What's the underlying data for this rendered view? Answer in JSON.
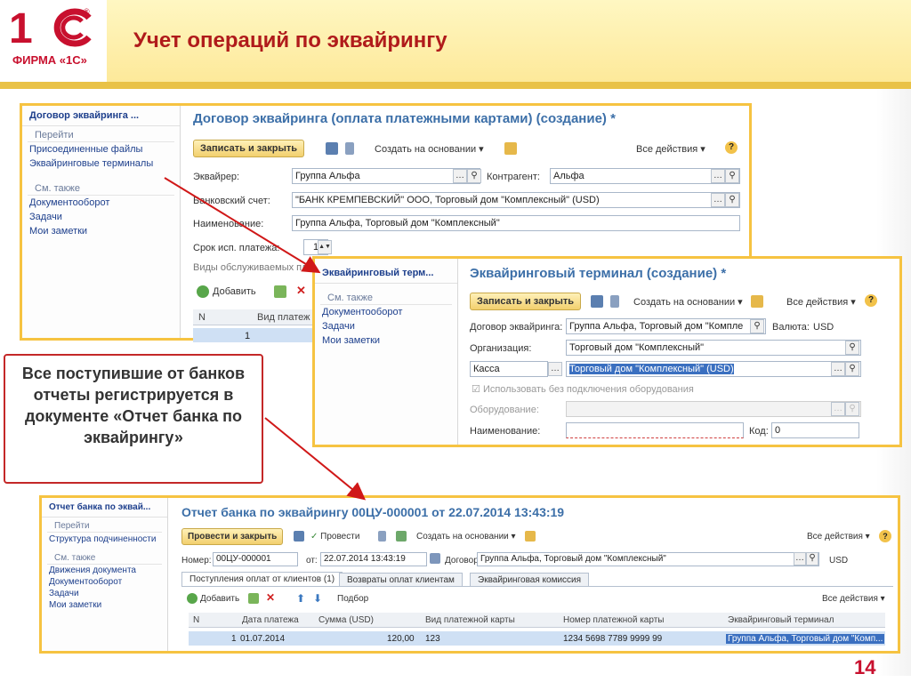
{
  "slide": {
    "logo_text": "ФИРМА «1С»",
    "title": "Учет операций по эквайрингу",
    "page_number": "14",
    "callout": "Все поступившие от банков отчеты регистрируется в документе «Отчет банка по эквайрингу»"
  },
  "colors": {
    "accent": "#f6c341",
    "title": "#b01b1b",
    "link": "#1d3f8c",
    "window_title": "#3c6fa8"
  },
  "win1": {
    "side_title": "Договор эквайринга ...",
    "side_h1": "Перейти",
    "side_links1": [
      "Присоединенные файлы",
      "Эквайринговые терминалы"
    ],
    "side_h2": "См. также",
    "side_links2": [
      "Документооборот",
      "Задачи",
      "Мои заметки"
    ],
    "title": "Договор эквайринга (оплата платежными картами) (создание) *",
    "btn_save": "Записать и закрыть",
    "create_based": "Создать на основании",
    "all_actions": "Все действия",
    "acquirer_label": "Эквайрер:",
    "acquirer_value": "Группа Альфа",
    "counterparty_label": "Контрагент:",
    "counterparty_value": "Альфа",
    "bank_label": "Банковский счет:",
    "bank_value": "\"БАНК КРЕМПЕВСКИЙ\" ООО, Торговый дом \"Комплексный\" (USD)",
    "name_label": "Наименование:",
    "name_value": "Группа Альфа, Торговый дом \"Комплексный\"",
    "term_label": "Срок исп. платежа:",
    "term_value": "1",
    "types_label": "Виды обслуживаемых пл",
    "add_label": "Добавить",
    "grid_cols": [
      "N",
      "Вид платеж"
    ],
    "grid_row": [
      "1"
    ]
  },
  "win2": {
    "side_title": "Эквайринговый терм...",
    "side_h": "См. также",
    "side_links": [
      "Документооборот",
      "Задачи",
      "Мои заметки"
    ],
    "title": "Эквайринговый терминал (создание) *",
    "btn_save": "Записать и закрыть",
    "create_based": "Создать на основании",
    "all_actions": "Все действия",
    "contract_label": "Договор эквайринга:",
    "contract_value": "Группа Альфа, Торговый дом \"Компле",
    "currency_label": "Валюта:",
    "currency_value": "USD",
    "org_label": "Организация:",
    "org_value": "Торговый дом \"Комплексный\"",
    "cash_value": "Касса",
    "cash_account_value": "Торговый дом \"Комплексный\" (USD)",
    "offline_label": "Использовать без подключения оборудования",
    "equipment_label": "Оборудование:",
    "name_label": "Наименование:",
    "code_label": "Код:",
    "code_value": "0"
  },
  "win3": {
    "side_title": "Отчет банка по эквай...",
    "side_h1": "Перейти",
    "side_links1": [
      "Структура подчиненности"
    ],
    "side_h2": "См. также",
    "side_links2": [
      "Движения документа",
      "Документооборот",
      "Задачи",
      "Мои заметки"
    ],
    "title": "Отчет банка по эквайрингу 00ЦУ-000001 от 22.07.2014 13:43:19",
    "btn_post": "Провести и закрыть",
    "post": "Провести",
    "create_based": "Создать на основании",
    "all_actions": "Все действия",
    "number_label": "Номер:",
    "number_value": "00ЦУ-000001",
    "from_label": "от:",
    "date_value": "22.07.2014 13:43:19",
    "contract_label": "Договор:",
    "contract_value": "Группа Альфа, Торговый дом \"Комплексный\"",
    "currency_value": "USD",
    "tabs": [
      "Поступления оплат от клиентов (1)",
      "Возвраты оплат клиентам",
      "Эквайринговая комиссия"
    ],
    "add_label": "Добавить",
    "select_label": "Подбор",
    "grid_cols": [
      "N",
      "Дата платежа",
      "Сумма (USD)",
      "Вид платежной карты",
      "Номер платежной карты",
      "Эквайринговый терминал"
    ],
    "grid_row": [
      "1",
      "01.07.2014",
      "120,00",
      "123",
      "1234 5698 7789 9999 99",
      "Группа Альфа, Торговый дом \"Комп..."
    ]
  }
}
